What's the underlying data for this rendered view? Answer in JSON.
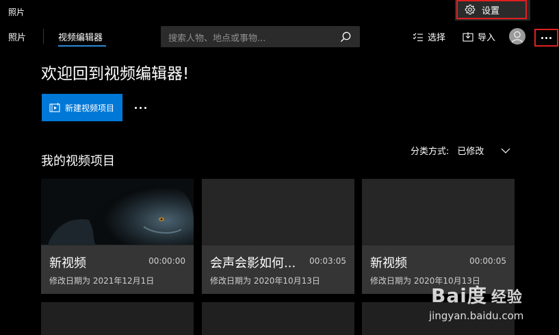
{
  "app": {
    "title": "照片"
  },
  "nav": {
    "photos_label": "照片",
    "video_editor_label": "视频编辑器"
  },
  "search": {
    "placeholder": "搜索人物、地点或事物..."
  },
  "toolbar": {
    "select_label": "选择",
    "import_label": "导入"
  },
  "dropdown": {
    "settings_label": "设置"
  },
  "main": {
    "welcome": "欢迎回到视频编辑器!",
    "new_project_label": "新建视频项目",
    "section_title": "我的视频项目",
    "sort_label": "分类方式:",
    "sort_value": "已修改"
  },
  "projects": [
    {
      "title": "新视频",
      "duration": "00:00:00",
      "date": "修改日期为 2021年12月1日",
      "has_thumbnail": true
    },
    {
      "title": "会声会影如何...",
      "duration": "00:03:05",
      "date": "修改日期为 2020年10月13日",
      "has_thumbnail": false
    },
    {
      "title": "新视频",
      "duration": "00:00:05",
      "date": "修改日期为 2020年10月13日",
      "has_thumbnail": false
    }
  ],
  "watermark": {
    "logo": "Bai度",
    "sub": "经验",
    "url": "jingyan.baidu.com"
  },
  "colors": {
    "accent": "#0078d7",
    "highlight_box": "#e02020",
    "background": "#000000",
    "card_info": "#353535"
  }
}
